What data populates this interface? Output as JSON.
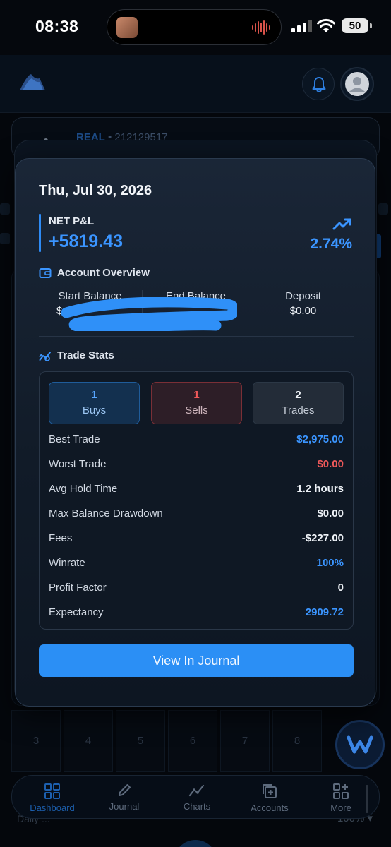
{
  "status_bar": {
    "time": "08:38",
    "battery": "50"
  },
  "background": {
    "account_type": "REAL",
    "account_number": "• 212129517",
    "calendar_days": [
      "3",
      "4",
      "5",
      "6",
      "7",
      "8"
    ],
    "below_left": "Daily ...",
    "below_right": "100% ▾"
  },
  "nav": {
    "items": [
      {
        "label": "Dashboard",
        "icon": "grid-icon"
      },
      {
        "label": "Journal",
        "icon": "pencil-icon"
      },
      {
        "label": "Charts",
        "icon": "chart-line-icon"
      },
      {
        "label": "Accounts",
        "icon": "accounts-icon"
      },
      {
        "label": "More",
        "icon": "more-grid-icon"
      }
    ],
    "active": "Dashboard"
  },
  "modal": {
    "date": "Thu, Jul 30, 2026",
    "net_pnl_label": "NET P&L",
    "net_pnl_value": "+5819.43",
    "net_pnl_percent": "2.74%",
    "account_overview": {
      "title": "Account Overview",
      "start_label": "Start Balance",
      "start_value": "$",
      "end_label": "End Balance",
      "end_value": "",
      "deposit_label": "Deposit",
      "deposit_value": "$0.00"
    },
    "trade_stats": {
      "title": "Trade Stats",
      "buys_count": "1",
      "buys_label": "Buys",
      "sells_count": "1",
      "sells_label": "Sells",
      "trades_count": "2",
      "trades_label": "Trades",
      "rows": [
        {
          "label": "Best Trade",
          "value": "$2,975.00",
          "color": "#3b95ff"
        },
        {
          "label": "Worst Trade",
          "value": "$0.00",
          "color": "#f0595a"
        },
        {
          "label": "Avg Hold Time",
          "value": "1.2 hours",
          "color": "#eef2f7"
        },
        {
          "label": "Max Balance Drawdown",
          "value": "$0.00",
          "color": "#eef2f7"
        },
        {
          "label": "Fees",
          "value": "-$227.00",
          "color": "#eef2f7"
        },
        {
          "label": "Winrate",
          "value": "100%",
          "color": "#3b95ff"
        },
        {
          "label": "Profit Factor",
          "value": "0",
          "color": "#eef2f7"
        },
        {
          "label": "Expectancy",
          "value": "2909.72",
          "color": "#3b95ff"
        }
      ]
    },
    "cta_label": "View In Journal"
  },
  "colors": {
    "accent": "#2b8ff5",
    "positive": "#3b95ff",
    "negative": "#f0595a"
  }
}
